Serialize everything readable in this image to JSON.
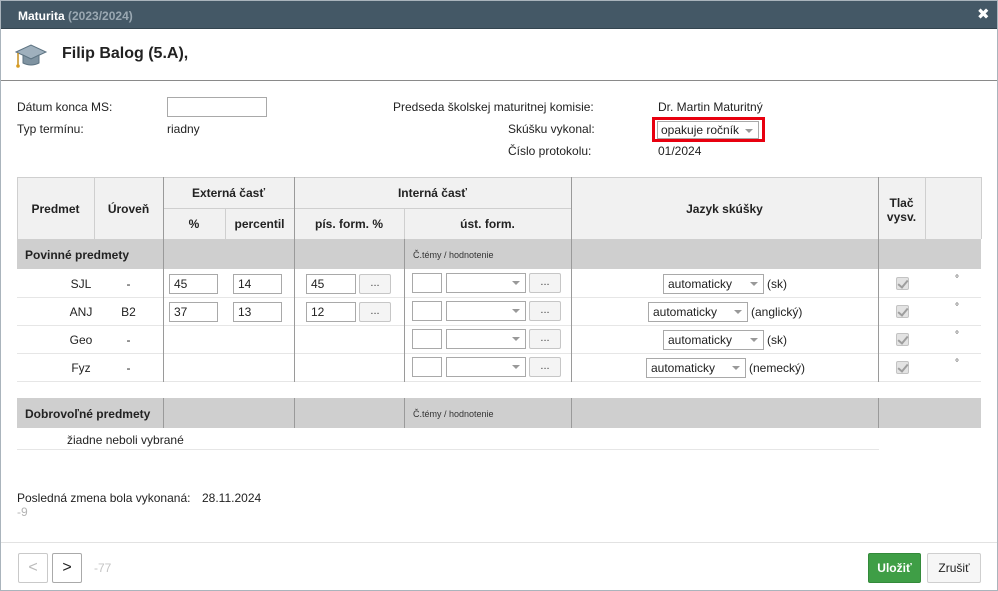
{
  "window": {
    "title": "Maturita",
    "title_years": "(2023/2024)"
  },
  "student": {
    "name": "Filip Balog (5.A),"
  },
  "info": {
    "end_date_label": "Dátum konca MS:",
    "end_date_value": "",
    "term_type_label": "Typ termínu:",
    "term_type_value": "riadny",
    "chairman_label": "Predseda školskej maturitnej komisie:",
    "chairman_value": "Dr. Martin Maturitný",
    "exam_done_label": "Skúšku vykonal:",
    "exam_done_value": "opakuje ročník",
    "protocol_label": "Číslo protokolu:",
    "protocol_value": "01/2024"
  },
  "table": {
    "headers": {
      "subject": "Predmet",
      "level": "Úroveň",
      "external": "Externá časť",
      "percent": "%",
      "percentile": "percentil",
      "internal": "Interná časť",
      "written_percent": "pís. form. %",
      "oral": "úst. form.",
      "language": "Jazyk skúšky",
      "print_line1": "Tlač",
      "print_line2": "vysv."
    },
    "mandatory_group": "Povinné predmety",
    "voluntary_group": "Dobrovoľné predmety",
    "oral_hint": "Č.témy / hodnotenie",
    "dots": "...",
    "degree": "°",
    "rows": [
      {
        "subject": "SJL",
        "level": "-",
        "ext_percent": "45",
        "ext_percentile": "14",
        "written": "45",
        "lang_mode": "automaticky",
        "lang_name": "(sk)"
      },
      {
        "subject": "ANJ",
        "level": "B2",
        "ext_percent": "37",
        "ext_percentile": "13",
        "written": "12",
        "lang_mode": "automaticky",
        "lang_name": "(anglický)"
      },
      {
        "subject": "Geo",
        "level": "-",
        "lang_mode": "automaticky",
        "lang_name": "(sk)"
      },
      {
        "subject": "Fyz",
        "level": "-",
        "lang_mode": "automaticky",
        "lang_name": "(nemecký)"
      }
    ],
    "voluntary_empty": "žiadne neboli vybrané"
  },
  "last_change": {
    "label": "Posledná zmena bola vykonaná:",
    "date": "28.11.2024",
    "code": "-9"
  },
  "footer": {
    "prev": "<",
    "next": ">",
    "counter": "-77",
    "save": "Uložiť",
    "cancel": "Zrušiť"
  },
  "colors": {
    "titlebar": "#445866",
    "save": "#3f9e46",
    "highlight": "#e8000f"
  }
}
